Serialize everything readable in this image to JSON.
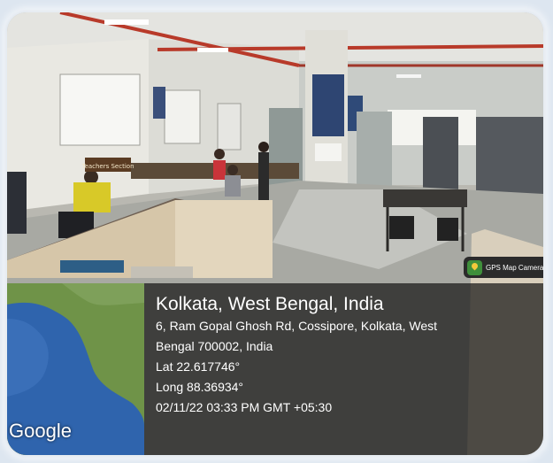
{
  "badge": {
    "label": "GPS Map Camera",
    "icon": "gps-map-camera-logo-icon"
  },
  "scene": {
    "sign_text": "Teachers Section"
  },
  "map": {
    "wordmark": "Google",
    "sea_color": "#2f64ad",
    "land_color": "#6f9348"
  },
  "location": {
    "title": "Kolkata, West Bengal, India",
    "address_line1": "6, Ram Gopal Ghosh Rd, Cossipore, Kolkata, West",
    "address_line2": "Bengal 700002, India",
    "lat": "Lat 22.617746°",
    "long": "Long 88.36934°",
    "datetime": "02/11/22 03:33 PM GMT +05:30"
  }
}
